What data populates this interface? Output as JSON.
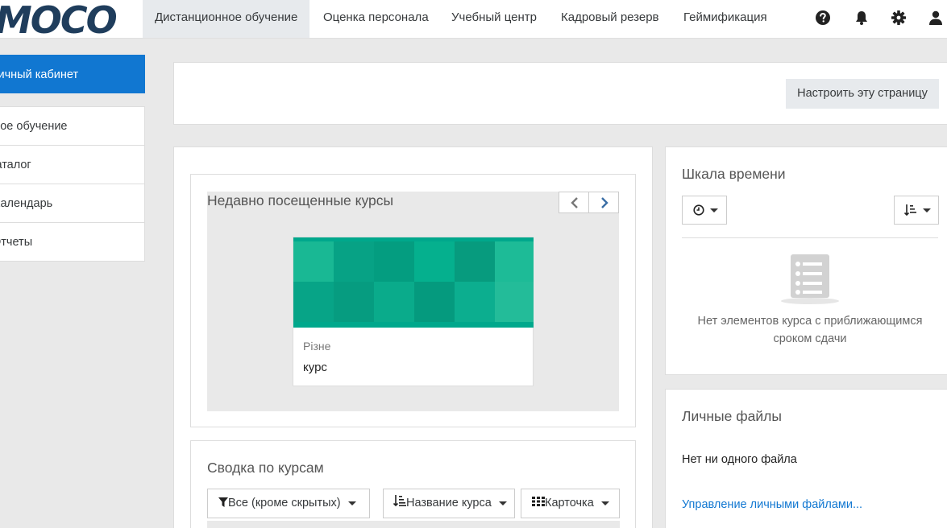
{
  "navbar": {
    "logo": "MOCO",
    "items": [
      {
        "label": "Дистанционное обучение"
      },
      {
        "label": "Оценка персонала"
      },
      {
        "label": "Учебный центр"
      },
      {
        "label": "Кадровый резерв"
      },
      {
        "label": "Геймификация"
      }
    ],
    "icons": [
      "help-icon",
      "bell-icon",
      "gear-icon",
      "user-icon"
    ]
  },
  "sidebar": {
    "dashboard": "Личный кабинет",
    "items": [
      {
        "label": "Мое обучение"
      },
      {
        "label": "Каталог"
      },
      {
        "label": "Календарь"
      },
      {
        "label": "Отчеты"
      }
    ]
  },
  "top_card": {
    "customize_button": "Настроить эту страницу"
  },
  "recent_courses": {
    "title": "Недавно посещенные курсы",
    "course": {
      "category": "Різне",
      "name": "курс"
    },
    "colors": {
      "accent": "#00a88c"
    }
  },
  "course_overview": {
    "title": "Сводка по курсам",
    "filter_label": "Все (кроме скрытых)",
    "sort_label": "Название курса",
    "view_label": "Карточка"
  },
  "timeline": {
    "title": "Шкала времени",
    "empty_text_line1": "Нет элементов курса с приближающимся",
    "empty_text_line2": "сроком сдачи"
  },
  "private_files": {
    "title": "Личные файлы",
    "empty_text": "Нет ни одного файла",
    "manage_link": "Управление личными файлами..."
  }
}
